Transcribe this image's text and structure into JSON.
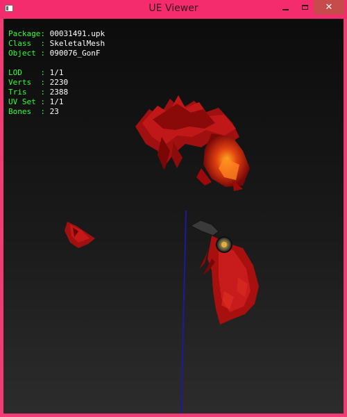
{
  "window": {
    "title": "UE Viewer"
  },
  "titlebar": {
    "close_glyph": "✕"
  },
  "info": {
    "package": {
      "label": "Package:",
      "value": "00031491.upk"
    },
    "class": {
      "label": "Class  :",
      "value": "SkeletalMesh"
    },
    "object": {
      "label": "Object :",
      "value": "090076_GonF"
    },
    "lod": {
      "label": "LOD    :",
      "value": "1/1"
    },
    "verts": {
      "label": "Verts  :",
      "value": "2230"
    },
    "tris": {
      "label": "Tris   :",
      "value": "2388"
    },
    "uvset": {
      "label": "UV Set :",
      "value": "1/1"
    },
    "bones": {
      "label": "Bones  :",
      "value": "23"
    }
  },
  "colors": {
    "titlebar": "#f42b6c",
    "label_text": "#32ff32",
    "value_text": "#ffffff",
    "mesh_red": "#b01010",
    "axis_blue": "#1a1aa0"
  }
}
